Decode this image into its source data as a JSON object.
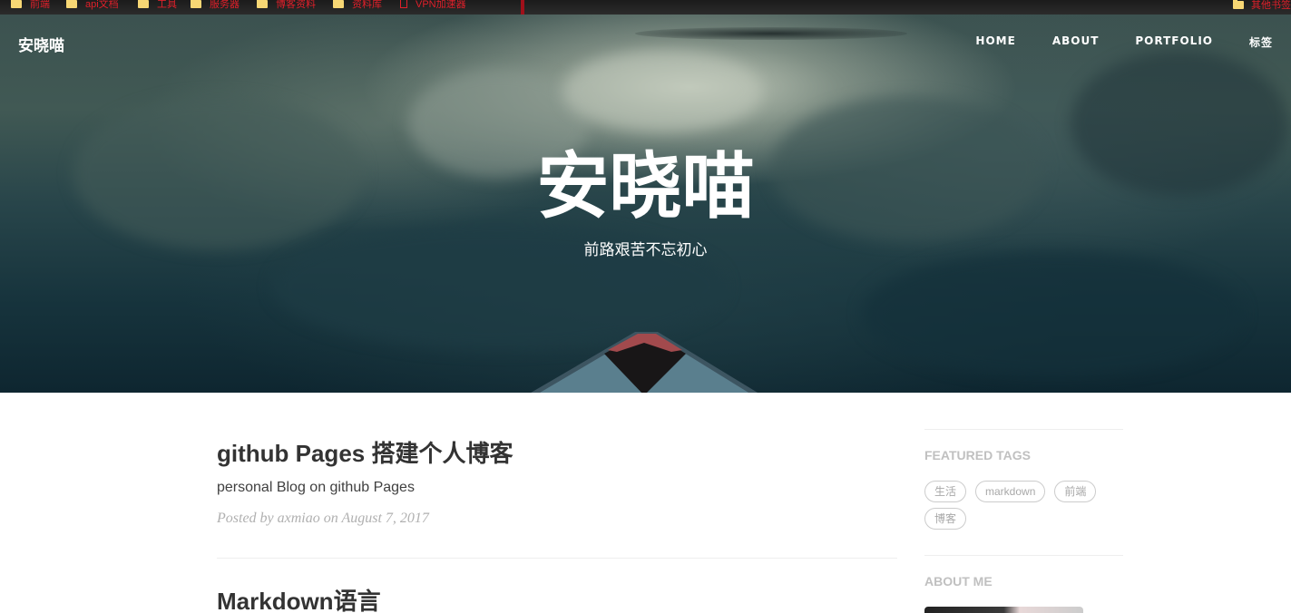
{
  "bookmarks": {
    "items": [
      {
        "label": "前端",
        "icon": "folder-icon"
      },
      {
        "label": "api文档",
        "icon": "folder-icon"
      },
      {
        "label": "工具",
        "icon": "folder-icon"
      },
      {
        "label": "服务器",
        "icon": "folder-icon"
      },
      {
        "label": "博客资料",
        "icon": "folder-icon"
      },
      {
        "label": "资料库",
        "icon": "folder-icon"
      },
      {
        "label": "VPN加速器",
        "icon": "page-icon"
      }
    ],
    "right_label": "其他书签"
  },
  "nav": {
    "brand": "安晓喵",
    "links": [
      "HOME",
      "ABOUT",
      "PORTFOLIO",
      "标签"
    ]
  },
  "hero": {
    "title": "安晓喵",
    "subtitle": "前路艰苦不忘初心"
  },
  "posts": [
    {
      "title": "github Pages 搭建个人博客",
      "subtitle": "personal Blog on github Pages",
      "meta": "Posted by axmiao on August 7, 2017"
    },
    {
      "title": "Markdown语言"
    }
  ],
  "sidebar": {
    "featured_tags_heading": "FEATURED TAGS",
    "tags": [
      "生活",
      "markdown",
      "前端",
      "博客"
    ],
    "about_heading": "ABOUT ME"
  },
  "colors": {
    "bookmark_text": "#e0202a",
    "tag_text": "#a8a8a8",
    "heading_gray": "#c0c0c0"
  }
}
